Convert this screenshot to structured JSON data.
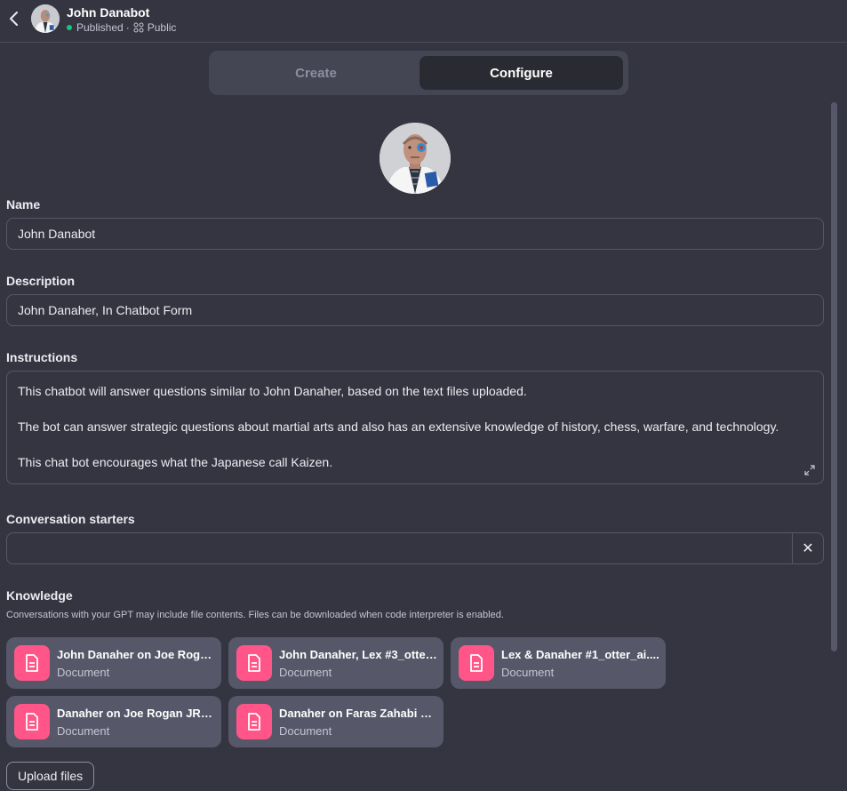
{
  "header": {
    "title": "John Danabot",
    "status": "Published",
    "separator": "·",
    "visibility": "Public"
  },
  "tabs": [
    {
      "label": "Create",
      "active": false
    },
    {
      "label": "Configure",
      "active": true
    }
  ],
  "form": {
    "name_label": "Name",
    "name_value": "John Danabot",
    "description_label": "Description",
    "description_value": "John Danaher, In Chatbot Form",
    "instructions_label": "Instructions",
    "instructions_lines": [
      "This chatbot will answer questions similar to John Danaher, based on the text files uploaded.",
      "The bot can answer strategic questions about martial arts and also has an extensive knowledge of history, chess, warfare, and technology.",
      "This chat bot encourages what the Japanese call Kaizen."
    ],
    "starters_label": "Conversation starters",
    "starters_value": "",
    "starters_clear": "✕",
    "knowledge_label": "Knowledge",
    "knowledge_note": "Conversations with your GPT may include file contents. Files can be downloaded when code interpreter is enabled.",
    "files": [
      {
        "name": "John Danaher on Joe Rogan...",
        "type": "Document"
      },
      {
        "name": "John Danaher, Lex #3_otter...",
        "type": "Document"
      },
      {
        "name": "Lex & Danaher #1_otter_ai....",
        "type": "Document"
      },
      {
        "name": "Danaher on Joe Rogan JRE...",
        "type": "Document"
      },
      {
        "name": "Danaher on Faras Zahabi E...",
        "type": "Document"
      }
    ],
    "upload_label": "Upload files"
  },
  "colors": {
    "background": "#343541",
    "file_icon": "#ff5588",
    "status_dot": "#19c37d"
  }
}
